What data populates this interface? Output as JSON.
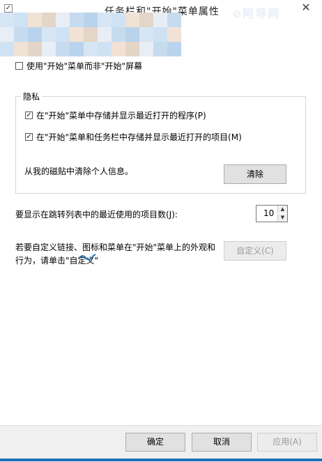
{
  "window": {
    "title": "任务栏和\"开始\"菜单属性",
    "close_glyph": "✕",
    "watermark": "⊘阿导网"
  },
  "options": {
    "use_start_menu_label": "使用\"开始\"菜单而非\"开始\"屏幕",
    "use_start_menu_checked": false
  },
  "privacy": {
    "group_title": "隐私",
    "store_programs_label": "在\"开始\"菜单中存储并显示最近打开的程序(P)",
    "store_programs_checked": true,
    "store_items_label": "在\"开始\"菜单和任务栏中存储并显示最近打开的项目(M)",
    "store_items_checked": true,
    "clear_info_label": "从我的磁贴中清除个人信息。",
    "clear_button": "清除"
  },
  "jumplist": {
    "label": "要显示在跳转列表中的最近使用的项目数(J):",
    "value": "10"
  },
  "customize": {
    "label_line1": "若要自定义链接、图标和菜单在\"开始\"菜单上的外观和",
    "label_line2": "行为，请单击\"自定义\"",
    "button": "自定义(C)"
  },
  "footer": {
    "ok": "确定",
    "cancel": "取消",
    "apply": "应用(A)"
  },
  "colors": {
    "accent": "#1f6fb5",
    "pixelation": [
      "#d7e6f5",
      "#c7dbef",
      "#e3d5c8",
      "#cfe2f3",
      "#b9d3ec",
      "#e8eef5",
      "#f2e2d6"
    ]
  }
}
